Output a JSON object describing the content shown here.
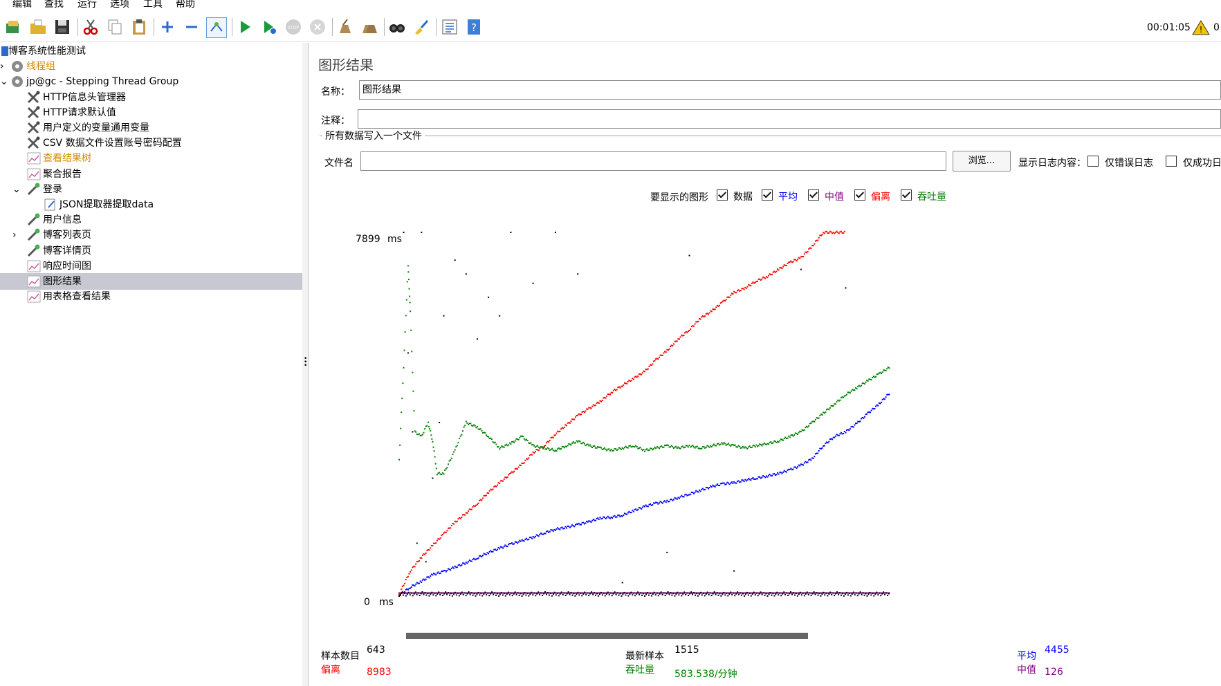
{
  "menu": [
    "编辑",
    "查找",
    "运行",
    "选项",
    "工具",
    "帮助"
  ],
  "toolbar": {
    "icons": [
      "templates-icon",
      "open-icon",
      "save-icon",
      "cut-icon",
      "copy-icon",
      "paste-icon",
      "expand-icon",
      "collapse-icon",
      "toggle-icon",
      "start-icon",
      "start-no-pause-icon",
      "stop-icon",
      "shutdown-icon",
      "clear-icon",
      "clear-all-icon",
      "search-icon",
      "reset-search-icon",
      "function-helper-icon",
      "help-icon"
    ],
    "elapsed": "00:01:05",
    "warning_count": "0"
  },
  "tree": {
    "items": [
      {
        "label": "博客系统性能测试",
        "icon": "testplan-icon"
      },
      {
        "label": "线程组",
        "icon": "gear-icon",
        "disabled": true
      },
      {
        "label": "jp@gc - Stepping Thread Group",
        "icon": "gear-icon"
      },
      {
        "label": "HTTP信息头管理器",
        "icon": "config-icon"
      },
      {
        "label": "HTTP请求默认值",
        "icon": "config-icon"
      },
      {
        "label": "用户定义的变量通用变量",
        "icon": "config-icon"
      },
      {
        "label": "CSV 数据文件设置账号密码配置",
        "icon": "config-icon"
      },
      {
        "label": "查看结果树",
        "icon": "listener-icon",
        "disabled": true
      },
      {
        "label": "聚合报告",
        "icon": "listener-icon"
      },
      {
        "label": "登录",
        "icon": "sampler-icon"
      },
      {
        "label": "JSON提取器提取data",
        "icon": "extractor-icon"
      },
      {
        "label": "用户信息",
        "icon": "sampler-icon"
      },
      {
        "label": "博客列表页",
        "icon": "sampler-icon"
      },
      {
        "label": "博客详情页",
        "icon": "sampler-icon"
      },
      {
        "label": "响应时间图",
        "icon": "listener-icon"
      },
      {
        "label": "图形结果",
        "icon": "listener-icon",
        "selected": true
      },
      {
        "label": "用表格查看结果",
        "icon": "listener-icon"
      }
    ]
  },
  "panel": {
    "title": "图形结果",
    "name_label": "名称：",
    "name_value": "图形结果",
    "comment_label": "注释：",
    "comment_value": "",
    "group_label": "所有数据写入一个文件",
    "file_label": "文件名",
    "file_value": "",
    "browse_label": "浏览...",
    "log_label": "显示日志内容：",
    "errors_only_label": "仅错误日志",
    "success_only_label": "仅成功日"
  },
  "graph_options": {
    "label": "要显示的图形",
    "items": [
      {
        "label": "数据",
        "color": "#000000",
        "checked": true
      },
      {
        "label": "平均",
        "color": "#0000ff",
        "checked": true
      },
      {
        "label": "中值",
        "color": "#800080",
        "checked": true
      },
      {
        "label": "偏离",
        "color": "#ff0000",
        "checked": true
      },
      {
        "label": "吞吐量",
        "color": "#008000",
        "checked": true
      }
    ]
  },
  "chart_data": {
    "type": "scatter",
    "y_max_label": "7899",
    "y_min_label": "0",
    "y_unit": "ms",
    "ylim": [
      0,
      7899
    ],
    "samples": 643,
    "series": [
      {
        "name": "平均",
        "color": "#0000ff",
        "points": [
          [
            0,
            80
          ],
          [
            5,
            250
          ],
          [
            10,
            380
          ],
          [
            15,
            520
          ],
          [
            20,
            590
          ],
          [
            25,
            680
          ],
          [
            30,
            780
          ],
          [
            35,
            880
          ],
          [
            40,
            1000
          ],
          [
            45,
            1090
          ],
          [
            50,
            1180
          ],
          [
            55,
            1250
          ],
          [
            60,
            1330
          ],
          [
            65,
            1420
          ],
          [
            70,
            1500
          ],
          [
            75,
            1540
          ],
          [
            80,
            1600
          ],
          [
            85,
            1660
          ],
          [
            90,
            1740
          ],
          [
            95,
            1760
          ],
          [
            100,
            1800
          ],
          [
            105,
            1900
          ],
          [
            110,
            1990
          ],
          [
            115,
            2060
          ],
          [
            120,
            2100
          ],
          [
            125,
            2180
          ],
          [
            130,
            2260
          ],
          [
            135,
            2340
          ],
          [
            140,
            2420
          ],
          [
            145,
            2480
          ],
          [
            150,
            2500
          ],
          [
            155,
            2560
          ],
          [
            160,
            2600
          ],
          [
            165,
            2650
          ],
          [
            170,
            2700
          ],
          [
            175,
            2780
          ],
          [
            180,
            2880
          ],
          [
            185,
            3020
          ],
          [
            190,
            3300
          ],
          [
            195,
            3500
          ],
          [
            200,
            3600
          ],
          [
            205,
            3780
          ],
          [
            210,
            4000
          ],
          [
            215,
            4200
          ],
          [
            220,
            4455
          ]
        ]
      },
      {
        "name": "中值",
        "color": "#800080",
        "points": [
          [
            0,
            126
          ],
          [
            220,
            126
          ]
        ]
      },
      {
        "name": "偏离",
        "color": "#ff0000",
        "points": [
          [
            0,
            100
          ],
          [
            5,
            600
          ],
          [
            10,
            900
          ],
          [
            15,
            1150
          ],
          [
            20,
            1400
          ],
          [
            25,
            1650
          ],
          [
            30,
            1850
          ],
          [
            35,
            2050
          ],
          [
            40,
            2300
          ],
          [
            45,
            2500
          ],
          [
            50,
            2700
          ],
          [
            55,
            2900
          ],
          [
            60,
            3150
          ],
          [
            65,
            3300
          ],
          [
            70,
            3550
          ],
          [
            75,
            3750
          ],
          [
            80,
            3950
          ],
          [
            85,
            4100
          ],
          [
            90,
            4250
          ],
          [
            95,
            4450
          ],
          [
            100,
            4600
          ],
          [
            105,
            4750
          ],
          [
            110,
            4900
          ],
          [
            115,
            5150
          ],
          [
            120,
            5350
          ],
          [
            125,
            5600
          ],
          [
            130,
            5800
          ],
          [
            135,
            6050
          ],
          [
            140,
            6200
          ],
          [
            145,
            6400
          ],
          [
            150,
            6600
          ],
          [
            155,
            6700
          ],
          [
            160,
            6850
          ],
          [
            165,
            6950
          ],
          [
            170,
            7100
          ],
          [
            175,
            7250
          ],
          [
            180,
            7350
          ],
          [
            185,
            7600
          ],
          [
            190,
            7900
          ],
          [
            195,
            8500
          ],
          [
            200,
            8983
          ]
        ]
      },
      {
        "name": "吞吐量",
        "color": "#008000",
        "points": [
          [
            0,
            3000
          ],
          [
            2,
            5000
          ],
          [
            4,
            7200
          ],
          [
            5,
            6200
          ],
          [
            7,
            3600
          ],
          [
            10,
            3500
          ],
          [
            13,
            3800
          ],
          [
            15,
            3400
          ],
          [
            17,
            2700
          ],
          [
            20,
            2700
          ],
          [
            25,
            3200
          ],
          [
            30,
            3800
          ],
          [
            35,
            3700
          ],
          [
            40,
            3500
          ],
          [
            45,
            3250
          ],
          [
            50,
            3350
          ],
          [
            55,
            3500
          ],
          [
            60,
            3300
          ],
          [
            65,
            3250
          ],
          [
            70,
            3200
          ],
          [
            75,
            3300
          ],
          [
            80,
            3400
          ],
          [
            85,
            3300
          ],
          [
            90,
            3250
          ],
          [
            95,
            3200
          ],
          [
            100,
            3250
          ],
          [
            105,
            3300
          ],
          [
            110,
            3200
          ],
          [
            115,
            3250
          ],
          [
            120,
            3300
          ],
          [
            125,
            3250
          ],
          [
            130,
            3300
          ],
          [
            135,
            3250
          ],
          [
            140,
            3300
          ],
          [
            145,
            3350
          ],
          [
            150,
            3300
          ],
          [
            155,
            3250
          ],
          [
            160,
            3300
          ],
          [
            165,
            3350
          ],
          [
            170,
            3400
          ],
          [
            175,
            3500
          ],
          [
            180,
            3600
          ],
          [
            185,
            3800
          ],
          [
            190,
            4000
          ],
          [
            195,
            4200
          ],
          [
            200,
            4400
          ],
          [
            205,
            4550
          ],
          [
            210,
            4700
          ],
          [
            215,
            4850
          ],
          [
            220,
            5000
          ]
        ]
      }
    ],
    "data_points": [
      [
        2,
        7900
      ],
      [
        4,
        5300
      ],
      [
        6,
        3600
      ],
      [
        8,
        1200
      ],
      [
        10,
        8300
      ],
      [
        12,
        800
      ],
      [
        15,
        2600
      ],
      [
        18,
        3800
      ],
      [
        20,
        6100
      ],
      [
        25,
        7300
      ],
      [
        30,
        7000
      ],
      [
        35,
        5600
      ],
      [
        40,
        6500
      ],
      [
        45,
        6100
      ],
      [
        50,
        8700
      ],
      [
        60,
        6800
      ],
      [
        70,
        9000
      ],
      [
        80,
        7000
      ],
      [
        100,
        350
      ],
      [
        120,
        1000
      ],
      [
        130,
        7400
      ],
      [
        150,
        600
      ],
      [
        180,
        7100
      ],
      [
        200,
        6700
      ]
    ]
  },
  "stats": {
    "samples_label": "样本数目",
    "samples_value": "643",
    "latest_label": "最新样本",
    "latest_value": "1515",
    "average_label": "平均",
    "average_value": "4455",
    "deviation_label": "偏离",
    "deviation_value": "8983",
    "throughput_label": "吞吐量",
    "throughput_value": "583.538/分钟",
    "median_label": "中值",
    "median_value": "126"
  }
}
